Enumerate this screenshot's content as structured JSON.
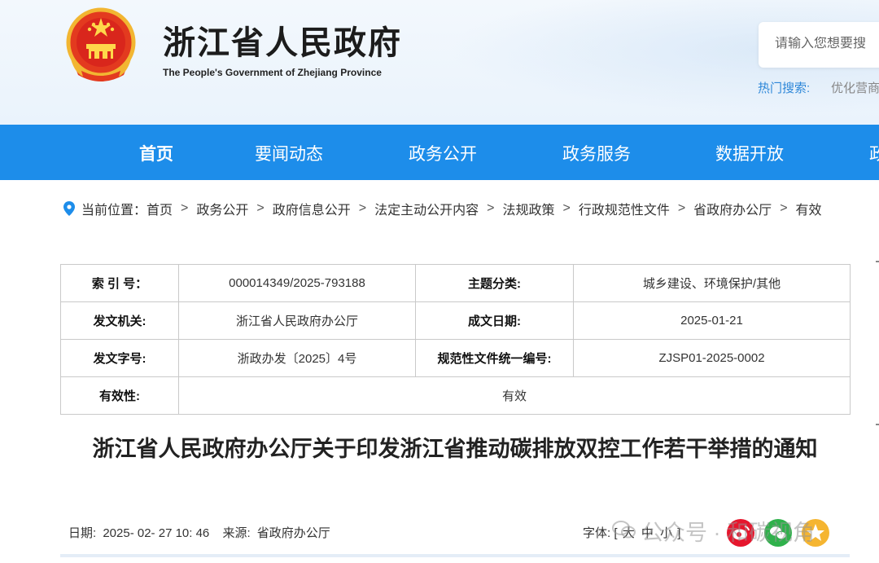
{
  "header": {
    "title": "浙江省人民政府",
    "subtitle": "The People's Government of Zhejiang Province",
    "search_placeholder": "请输入您想要搜",
    "hot_label": "热门搜索:",
    "hot_item": "优化营商"
  },
  "nav": {
    "items": [
      "首页",
      "要闻动态",
      "政务公开",
      "政务服务",
      "数据开放",
      "政"
    ]
  },
  "breadcrumb": {
    "prefix": "当前位置：",
    "items": [
      "首页",
      "政务公开",
      "政府信息公开",
      "法定主动公开内容",
      "法规政策",
      "行政规范性文件",
      "省政府办公厅",
      "有效"
    ]
  },
  "info": {
    "index_label": "索 引 号：",
    "index_value": "000014349/2025-793188",
    "topic_label": "主题分类:",
    "topic_value": "城乡建设、环境保护/其他",
    "issuer_label": "发文机关:",
    "issuer_value": "浙江省人民政府办公厅",
    "date_label": "成文日期:",
    "date_value": "2025-01-21",
    "docno_label": "发文字号:",
    "docno_value": "浙政办发〔2025〕4号",
    "code_label": "规范性文件统一编号:",
    "code_value": "ZJSP01-2025-0002",
    "validity_label": "有效性:",
    "validity_value": "有效"
  },
  "document": {
    "title": "浙江省人民政府办公厅关于印发浙江省推动碳排放双控工作若干举措的通知"
  },
  "meta": {
    "date_label": "日期:",
    "date_value": "2025- 02- 27 10: 46",
    "source_label": "来源:",
    "source_value": "省政府办公厅",
    "font_label": "字体:",
    "font_open": "[",
    "font_large": "大",
    "font_medium": "中",
    "font_small": "小",
    "font_close": "]"
  },
  "watermark": {
    "text": "公众号 · 和碳视角"
  },
  "colors": {
    "nav_bg": "#1d8dea",
    "link_blue": "#2d87d8",
    "weibo": "#e6162d",
    "wechat": "#2fb14b",
    "qzone": "#f5b531"
  },
  "icons": {
    "emblem": "national-emblem-icon",
    "pin": "location-pin-icon",
    "share": [
      "weibo-icon",
      "wechat-icon",
      "qzone-icon"
    ]
  }
}
